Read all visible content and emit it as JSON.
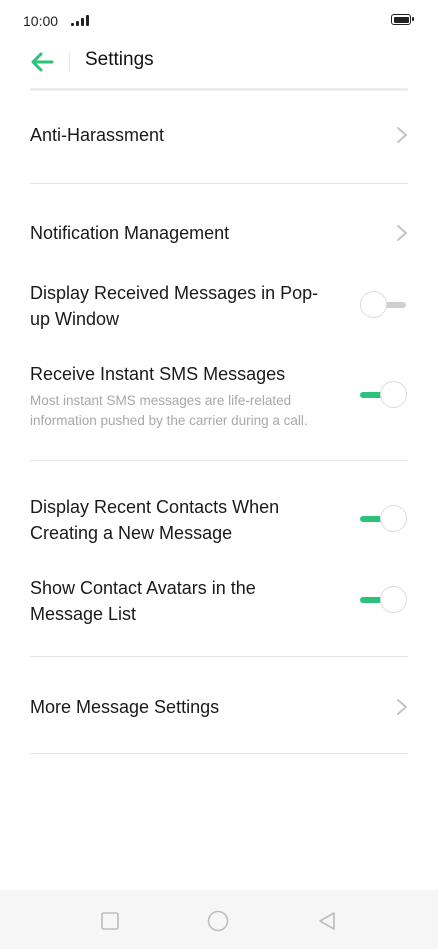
{
  "status": {
    "time": "10:00"
  },
  "header": {
    "title": "Settings"
  },
  "rows": {
    "anti_harassment": "Anti-Harassment",
    "notification_management": "Notification Management",
    "popup_window": {
      "label": "Display Received Messages in Pop-up Window",
      "enabled": false
    },
    "instant_sms": {
      "label": "Receive Instant SMS Messages",
      "description": "Most instant SMS messages are life-related information pushed by the carrier during a call.",
      "enabled": true
    },
    "recent_contacts": {
      "label": "Display Recent Contacts When Creating a New Message",
      "enabled": true
    },
    "contact_avatars": {
      "label": "Show Contact Avatars in the Message List",
      "enabled": true
    },
    "more_settings": "More Message Settings"
  },
  "colors": {
    "accent": "#2dc27b",
    "divider": "#e6e6e6",
    "secondary_text": "#a8a8a8"
  },
  "icons": [
    "back-arrow-icon",
    "chevron-right-icon",
    "square-icon",
    "circle-icon",
    "triangle-back-icon"
  ]
}
